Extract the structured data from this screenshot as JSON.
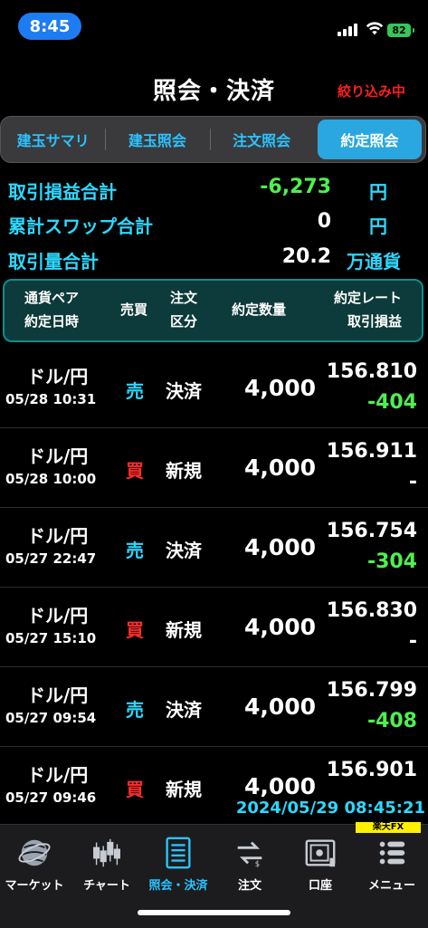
{
  "status_bar": {
    "time": "8:45",
    "battery": "82"
  },
  "header": {
    "title": "照会・決済",
    "filter_label": "絞り込み中"
  },
  "tabs": [
    {
      "label": "建玉サマリ",
      "active": false
    },
    {
      "label": "建玉照会",
      "active": false
    },
    {
      "label": "注文照会",
      "active": false
    },
    {
      "label": "約定照会",
      "active": true
    }
  ],
  "summary": [
    {
      "label": "取引損益合計",
      "value": "-6,273",
      "unit": "円",
      "value_color": "#4ef04e"
    },
    {
      "label": "累計スワップ合計",
      "value": "0",
      "unit": "円",
      "value_color": "#ffffff"
    },
    {
      "label": "取引量合計",
      "value": "20.2",
      "unit": "万通貨",
      "value_color": "#ffffff"
    }
  ],
  "table_header": {
    "pair": "通貨ペア",
    "datetime": "約定日時",
    "side": "売買",
    "order_type_1": "注文",
    "order_type_2": "区分",
    "qty": "約定数量",
    "rate": "約定レート",
    "pl": "取引損益"
  },
  "rows": [
    {
      "pair": "ドル/円",
      "datetime": "05/28 10:31",
      "side": "売",
      "type": "決済",
      "qty": "4,000",
      "rate": "156.810",
      "pl": "-404"
    },
    {
      "pair": "ドル/円",
      "datetime": "05/28 10:00",
      "side": "買",
      "type": "新規",
      "qty": "4,000",
      "rate": "156.911",
      "pl": "-"
    },
    {
      "pair": "ドル/円",
      "datetime": "05/27 22:47",
      "side": "売",
      "type": "決済",
      "qty": "4,000",
      "rate": "156.754",
      "pl": "-304"
    },
    {
      "pair": "ドル/円",
      "datetime": "05/27 15:10",
      "side": "買",
      "type": "新規",
      "qty": "4,000",
      "rate": "156.830",
      "pl": "-"
    },
    {
      "pair": "ドル/円",
      "datetime": "05/27 09:54",
      "side": "売",
      "type": "決済",
      "qty": "4,000",
      "rate": "156.799",
      "pl": "-408"
    },
    {
      "pair": "ドル/円",
      "datetime": "05/27 09:46",
      "side": "買",
      "type": "新規",
      "qty": "4,000",
      "rate": "156.901",
      "pl": ""
    }
  ],
  "colors": {
    "sell": "#2bd9ff",
    "buy": "#ff2d2d",
    "accent": "#2aa7e0",
    "profit_loss": "#4ef04e"
  },
  "timestamp": "2024/05/29 08:45:21",
  "brand": "楽天FX",
  "nav": [
    {
      "label": "マーケット",
      "icon": "globe-icon",
      "active": false
    },
    {
      "label": "チャート",
      "icon": "candlestick-icon",
      "active": false
    },
    {
      "label": "照会・決済",
      "icon": "document-list-icon",
      "active": true
    },
    {
      "label": "注文",
      "icon": "exchange-icon",
      "active": false
    },
    {
      "label": "口座",
      "icon": "safe-icon",
      "active": false
    },
    {
      "label": "メニュー",
      "icon": "menu-icon",
      "active": false
    }
  ]
}
